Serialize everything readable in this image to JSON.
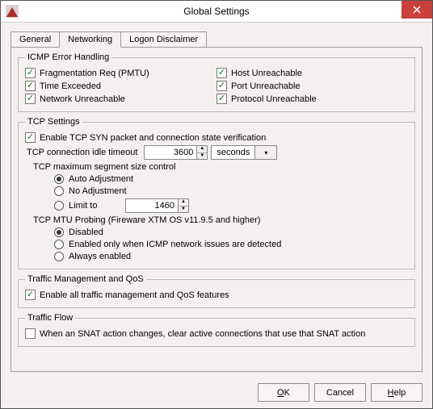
{
  "window": {
    "title": "Global Settings"
  },
  "tabs": {
    "general": "General",
    "networking": "Networking",
    "logon_disclaimer": "Logon Disclaimer"
  },
  "icmp": {
    "legend": "ICMP Error Handling",
    "frag_req": "Fragmentation Req (PMTU)",
    "time_exceeded": "Time Exceeded",
    "network_unreachable": "Network Unreachable",
    "host_unreachable": "Host Unreachable",
    "port_unreachable": "Port Unreachable",
    "protocol_unreachable": "Protocol Unreachable"
  },
  "tcp": {
    "legend": "TCP Settings",
    "enable_syn": "Enable TCP SYN packet and connection state verification",
    "idle_timeout_label": "TCP connection idle timeout",
    "idle_timeout_value": "3600",
    "idle_timeout_unit": "seconds",
    "mss_control": "TCP maximum segment size control",
    "auto_adjust": "Auto Adjustment",
    "no_adjust": "No Adjustment",
    "limit_to": "Limit to",
    "limit_value": "1460",
    "mtu_probing": "TCP MTU Probing (Fireware XTM OS v11.9.5 and higher)",
    "disabled": "Disabled",
    "enabled_icmp": "Enabled only when ICMP network issues are detected",
    "always": "Always enabled"
  },
  "qos": {
    "legend": "Traffic Management and QoS",
    "enable_all": "Enable all traffic management and QoS features"
  },
  "flow": {
    "legend": "Traffic Flow",
    "snat": "When an SNAT action changes, clear active connections that use that SNAT action"
  },
  "buttons": {
    "ok": "OK",
    "cancel": "Cancel",
    "help": "Help"
  }
}
